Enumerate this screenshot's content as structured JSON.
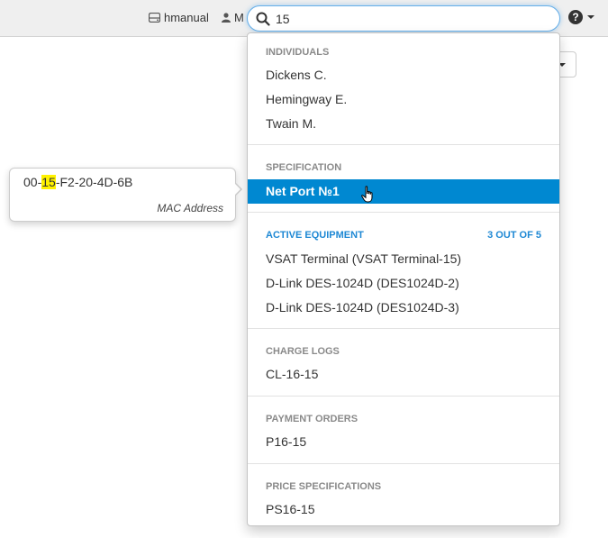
{
  "topbar": {
    "database_label": "hmanual",
    "user_label": "M",
    "help_label": "?"
  },
  "search": {
    "value": "15",
    "placeholder": ""
  },
  "tooltip": {
    "value_prefix": "00-",
    "value_highlight": "15",
    "value_suffix": "-F2-20-4D-6B",
    "label": "MAC Address"
  },
  "results": {
    "individuals": {
      "header": "INDIVIDUALS",
      "items": [
        "Dickens C.",
        "Hemingway E.",
        "Twain M."
      ]
    },
    "specification": {
      "header": "SPECIFICATION",
      "items": [
        "Net Port №1"
      ]
    },
    "active_equipment": {
      "header": "ACTIVE EQUIPMENT",
      "count": "3 OUT OF 5",
      "items": [
        "VSAT Terminal (VSAT Terminal-15)",
        "D-Link DES-1024D (DES1024D-2)",
        "D-Link DES-1024D (DES1024D-3)"
      ]
    },
    "charge_logs": {
      "header": "CHARGE LOGS",
      "items": [
        "CL-16-15"
      ]
    },
    "payment_orders": {
      "header": "PAYMENT ORDERS",
      "items": [
        "P16-15"
      ]
    },
    "price_specifications": {
      "header": "PRICE SPECIFICATIONS",
      "items": [
        "PS16-15"
      ]
    }
  },
  "icons": {
    "database": "database-icon",
    "user": "user-icon",
    "search": "search-icon",
    "help": "help-icon",
    "cursor": "hand-pointer-icon"
  },
  "colors": {
    "accent": "#0088d1",
    "section_header": "#8a8a8a",
    "active_header": "#1e88d4",
    "highlight": "#fff200"
  }
}
